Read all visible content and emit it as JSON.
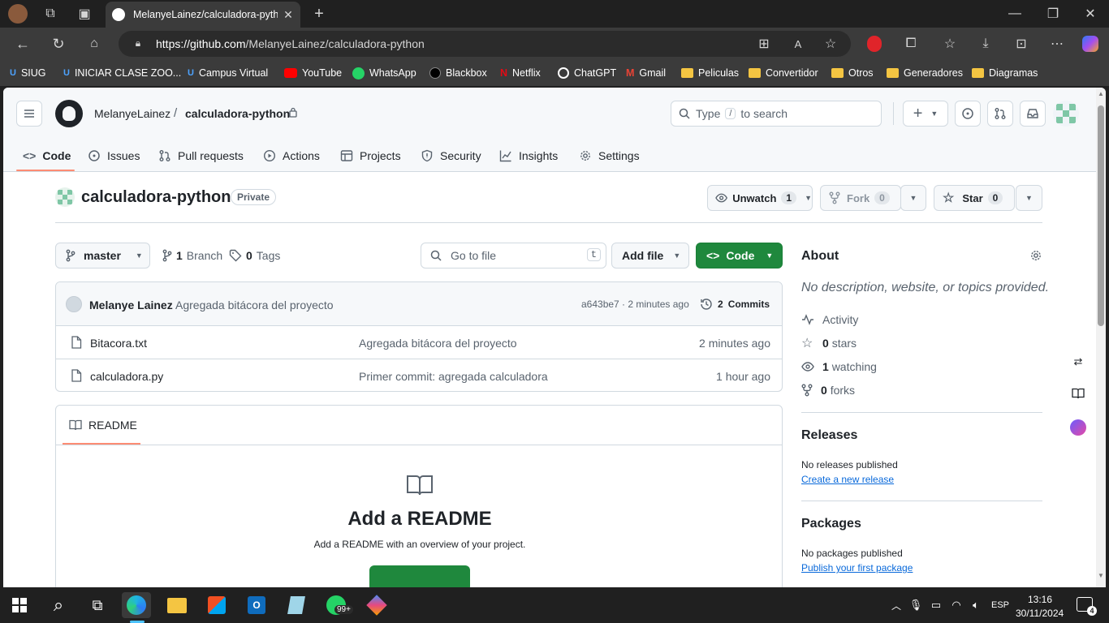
{
  "browser": {
    "tab_title": "MelanyeLainez/calculadora-pytho",
    "url_host": "https://github.com",
    "url_path": "/MelanyeLainez/calculadora-python",
    "bookmarks": [
      "SIUG",
      "INICIAR CLASE ZOO...",
      "Campus Virtual",
      "YouTube",
      "WhatsApp",
      "Blackbox",
      "Netflix",
      "ChatGPT",
      "Gmail",
      "Peliculas",
      "Convertidor",
      "Otros",
      "Generadores",
      "Diagramas"
    ]
  },
  "header": {
    "owner": "MelanyeLainez",
    "separator": "/",
    "repo": "calculadora-python",
    "search_prefix": "Type",
    "search_key": "/",
    "search_suffix": "to search"
  },
  "nav": {
    "tabs": [
      "Code",
      "Issues",
      "Pull requests",
      "Actions",
      "Projects",
      "Security",
      "Insights",
      "Settings"
    ]
  },
  "repo": {
    "title": "calculadora-python",
    "visibility": "Private",
    "unwatch_label": "Unwatch",
    "unwatch_count": "1",
    "fork_label": "Fork",
    "fork_count": "0",
    "star_label": "Star",
    "star_count": "0"
  },
  "toolbar": {
    "branch": "master",
    "branches_count": "1",
    "branches_label": "Branch",
    "tags_count": "0",
    "tags_label": "Tags",
    "goto_placeholder": "Go to file",
    "goto_key": "t",
    "add_file": "Add file",
    "code": "Code"
  },
  "commit": {
    "author": "Melanye Lainez",
    "message": "Agregada bitácora del proyecto",
    "hash_time": "a643be7 · 2 minutes ago",
    "commits_count": "2",
    "commits_label": "Commits"
  },
  "files": [
    {
      "name": "Bitacora.txt",
      "message": "Agregada bitácora del proyecto",
      "time": "2 minutes ago"
    },
    {
      "name": "calculadora.py",
      "message": "Primer commit: agregada calculadora",
      "time": "1 hour ago"
    }
  ],
  "readme": {
    "tab": "README",
    "heading": "Add a README",
    "sub": "Add a README with an overview of your project."
  },
  "about": {
    "title": "About",
    "desc": "No description, website, or topics provided.",
    "activity": "Activity",
    "stars_count": "0",
    "stars_label": "stars",
    "watching_count": "1",
    "watching_label": "watching",
    "forks_count": "0",
    "forks_label": "forks",
    "releases_title": "Releases",
    "releases_none": "No releases published",
    "releases_link": "Create a new release",
    "packages_title": "Packages",
    "packages_none": "No packages published",
    "packages_link": "Publish your first package"
  },
  "taskbar": {
    "badge": "99+",
    "lang": "ESP",
    "time": "13:16",
    "date": "30/11/2024",
    "notif": "4"
  },
  "colors": {
    "code_button": "#1f883d",
    "link": "#0969da",
    "accent_underline": "#fd8c73"
  }
}
